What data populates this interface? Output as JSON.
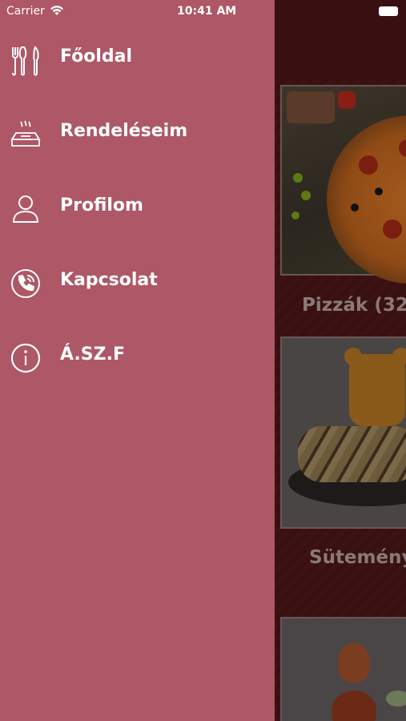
{
  "status_bar": {
    "carrier": "Carrier",
    "time": "10:41 AM"
  },
  "drawer": {
    "background": "#ad5767",
    "items": [
      {
        "label": "Főoldal",
        "icon": "cutlery-icon"
      },
      {
        "label": "Rendeléseim",
        "icon": "hot-dish-icon"
      },
      {
        "label": "Profilom",
        "icon": "user-icon"
      },
      {
        "label": "Kapcsolat",
        "icon": "phone-icon"
      },
      {
        "label": "Á.SZ.F",
        "icon": "info-icon"
      }
    ]
  },
  "background_app": {
    "header_color": "#3a0f12",
    "categories": [
      {
        "title": "Pizzák (32"
      },
      {
        "title": "Sütemény"
      }
    ]
  }
}
